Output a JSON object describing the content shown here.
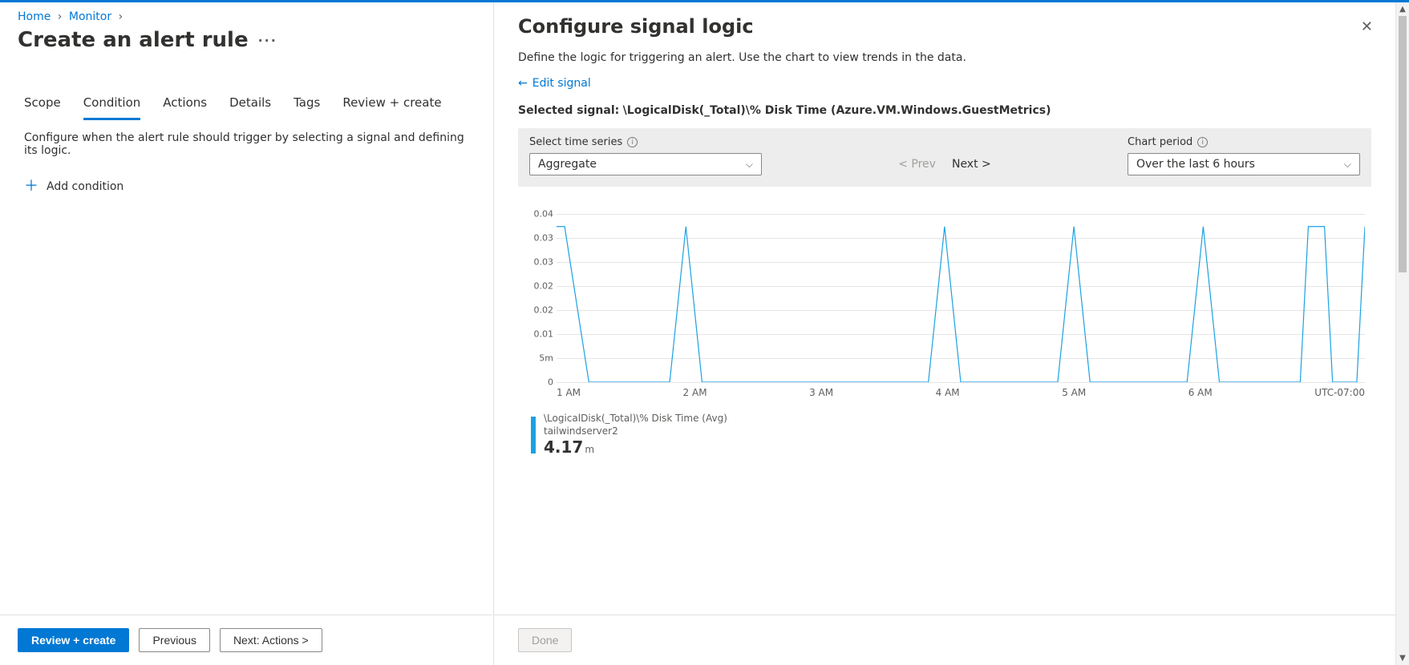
{
  "breadcrumbs": {
    "home": "Home",
    "monitor": "Monitor"
  },
  "page_title": "Create an alert rule",
  "tabs": {
    "scope": "Scope",
    "condition": "Condition",
    "actions": "Actions",
    "details": "Details",
    "tags": "Tags",
    "review": "Review + create"
  },
  "left": {
    "description": "Configure when the alert rule should trigger by selecting a signal and defining its logic.",
    "add_condition": "Add condition"
  },
  "footer": {
    "review": "Review + create",
    "previous": "Previous",
    "next": "Next: Actions  >"
  },
  "panel": {
    "title": "Configure signal logic",
    "subtitle": "Define the logic for triggering an alert. Use the chart to view trends in the data.",
    "edit_signal": "Edit signal",
    "selected_label": "Selected signal:",
    "selected_value": "\\LogicalDisk(_Total)\\% Disk Time (Azure.VM.Windows.GuestMetrics)",
    "ts_label": "Select time series",
    "ts_value": "Aggregate",
    "prev": "<  Prev",
    "next": "Next  >",
    "period_label": "Chart period",
    "period_value": "Over the last 6 hours",
    "done": "Done"
  },
  "legend": {
    "metric": "\\LogicalDisk(_Total)\\% Disk Time (Avg)",
    "resource": "tailwindserver2",
    "value": "4.17",
    "unit": "m"
  },
  "chart_data": {
    "type": "line",
    "title": "",
    "xlabel": "",
    "ylabel": "",
    "ylim": [
      0,
      0.04
    ],
    "y_ticks": [
      "0.04",
      "0.03",
      "0.03",
      "0.02",
      "0.02",
      "0.01",
      "5m",
      "0"
    ],
    "x_ticks": [
      "1 AM",
      "2 AM",
      "3 AM",
      "4 AM",
      "5 AM",
      "6 AM",
      "UTC-07:00"
    ],
    "series": [
      {
        "name": "\\LogicalDisk(_Total)\\% Disk Time (Avg) — tailwindserver2",
        "x": [
          0.0,
          0.01,
          0.04,
          0.14,
          0.16,
          0.18,
          0.46,
          0.48,
          0.5,
          0.62,
          0.64,
          0.66,
          0.78,
          0.8,
          0.82,
          0.92,
          0.93,
          0.95,
          0.96,
          0.99,
          1.0
        ],
        "values": [
          0.037,
          0.037,
          0.0,
          0.0,
          0.037,
          0.0,
          0.0,
          0.037,
          0.0,
          0.0,
          0.037,
          0.0,
          0.0,
          0.037,
          0.0,
          0.0,
          0.037,
          0.037,
          0.0,
          0.0,
          0.037
        ]
      }
    ]
  }
}
